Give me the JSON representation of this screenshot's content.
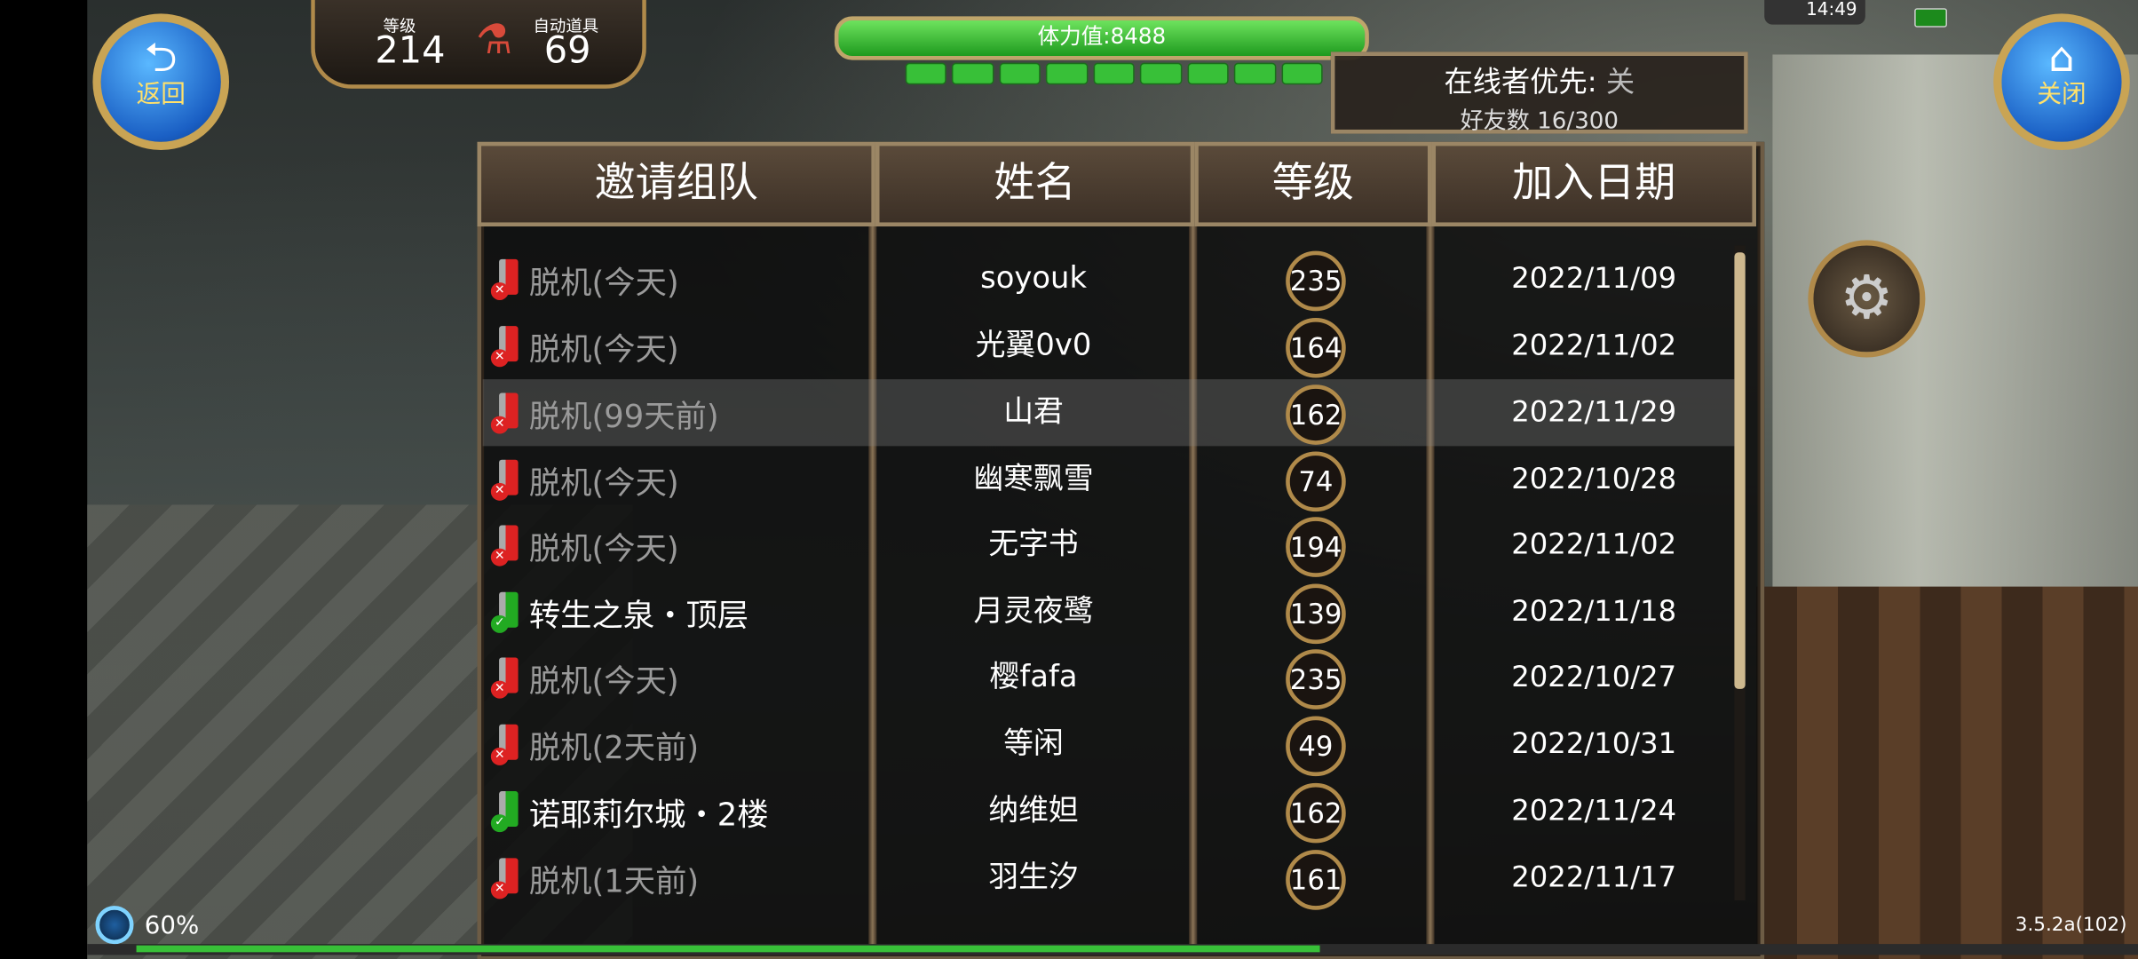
{
  "hud": {
    "level_label": "等级",
    "level_value": "214",
    "auto_items_label": "自动道具",
    "auto_items_value": "69",
    "stamina_text": "体力值:8488",
    "back_label": "返回",
    "close_label": "关闭",
    "clock": "14:49",
    "load_percent": "60%",
    "version": "3.5.2a(102)"
  },
  "online_panel": {
    "priority_label": "在线者优先:",
    "priority_value": "关",
    "friends_count": "好友数 16/300"
  },
  "table": {
    "headers": [
      "邀请组队",
      "姓名",
      "等级",
      "加入日期"
    ],
    "rows": [
      {
        "status": "脱机(今天)",
        "online": false,
        "name": "soyouk",
        "level": "235",
        "date": "2022/11/09"
      },
      {
        "status": "脱机(今天)",
        "online": false,
        "name": "光翼0v0",
        "level": "164",
        "date": "2022/11/02"
      },
      {
        "status": "脱机(99天前)",
        "online": false,
        "name": "山君",
        "level": "162",
        "date": "2022/11/29",
        "highlighted": true
      },
      {
        "status": "脱机(今天)",
        "online": false,
        "name": "幽寒飘雪",
        "level": "74",
        "date": "2022/10/28"
      },
      {
        "status": "脱机(今天)",
        "online": false,
        "name": "无字书",
        "level": "194",
        "date": "2022/11/02"
      },
      {
        "status": "转生之泉・顶层",
        "online": true,
        "name": "月灵夜鹭",
        "level": "139",
        "date": "2022/11/18"
      },
      {
        "status": "脱机(今天)",
        "online": false,
        "name": "樱fafa",
        "level": "235",
        "date": "2022/10/27"
      },
      {
        "status": "脱机(2天前)",
        "online": false,
        "name": "等闲",
        "level": "49",
        "date": "2022/10/31"
      },
      {
        "status": "诺耶莉尔城・2楼",
        "online": true,
        "name": "纳维妲",
        "level": "162",
        "date": "2022/11/24"
      },
      {
        "status": "脱机(1天前)",
        "online": false,
        "name": "羽生汐",
        "level": "161",
        "date": "2022/11/17"
      }
    ]
  },
  "colors": {
    "online": "#2aa52a",
    "offline": "#d22222",
    "frame": "#9b8665"
  }
}
